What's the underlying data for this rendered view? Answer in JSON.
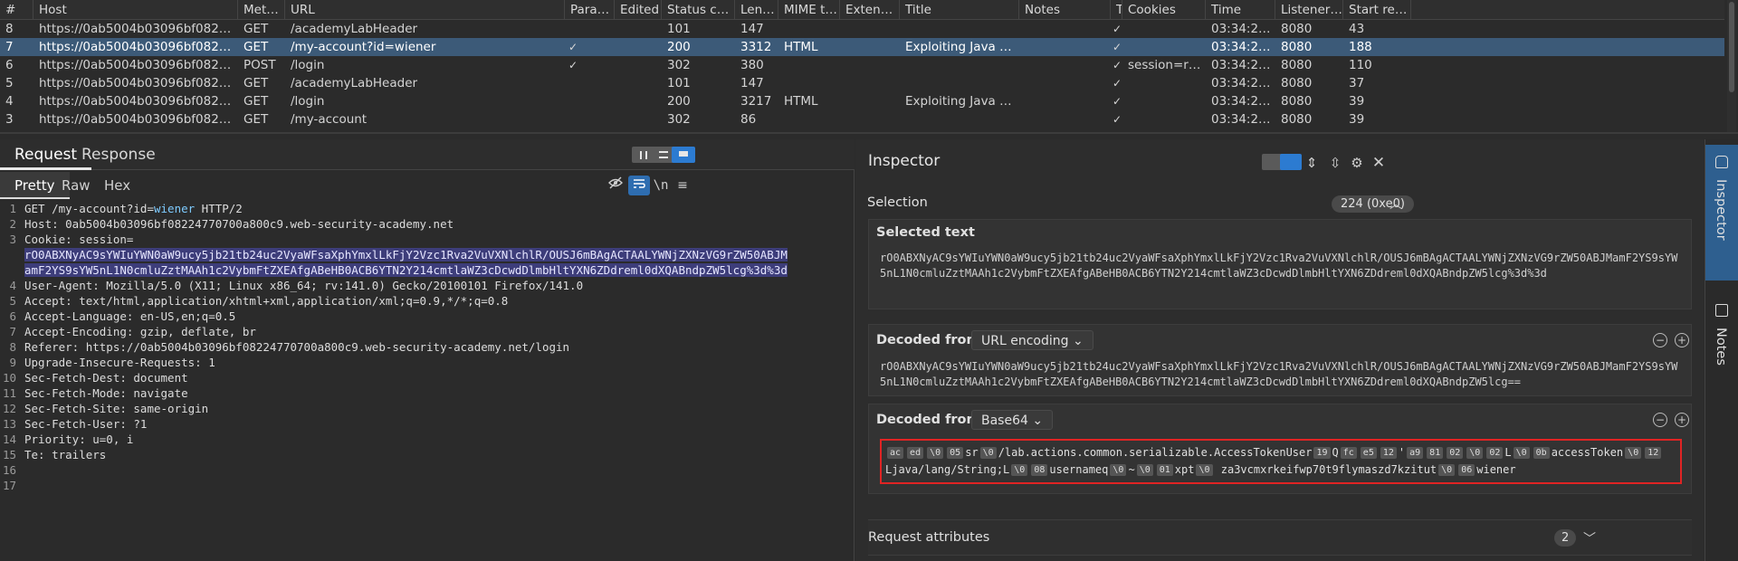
{
  "history": {
    "columns": [
      "#",
      "Host",
      "Method",
      "URL",
      "Params",
      "Edited",
      "Status code",
      "Length",
      "MIME type",
      "Extension",
      "Title",
      "Notes",
      "TLS",
      "Cookies",
      "Time",
      "Listener port",
      "Start respon"
    ],
    "rows": [
      {
        "num": "8",
        "host": "https://0ab5004b03096bf082247707...",
        "method": "GET",
        "url": "/academyLabHeader",
        "params": "",
        "status": "101",
        "length": "147",
        "mime": "",
        "title": "",
        "tls": "✓",
        "cookies": "",
        "time": "03:34:27 29 ...",
        "port": "8080",
        "start": "43"
      },
      {
        "num": "7",
        "host": "https://0ab5004b03096bf082247707...",
        "method": "GET",
        "url": "/my-account?id=wiener",
        "params": "✓",
        "status": "200",
        "length": "3312",
        "mime": "HTML",
        "title": "Exploiting Java deser...",
        "tls": "✓",
        "cookies": "",
        "time": "03:34:27 29 ...",
        "port": "8080",
        "start": "188"
      },
      {
        "num": "6",
        "host": "https://0ab5004b03096bf082247707...",
        "method": "POST",
        "url": "/login",
        "params": "✓",
        "status": "302",
        "length": "380",
        "mime": "",
        "title": "",
        "tls": "✓",
        "cookies": "session=rO0A...",
        "time": "03:34:27 29 ...",
        "port": "8080",
        "start": "110"
      },
      {
        "num": "5",
        "host": "https://0ab5004b03096bf082247707...",
        "method": "GET",
        "url": "/academyLabHeader",
        "params": "",
        "status": "101",
        "length": "147",
        "mime": "",
        "title": "",
        "tls": "✓",
        "cookies": "",
        "time": "03:34:24 29 ...",
        "port": "8080",
        "start": "37"
      },
      {
        "num": "4",
        "host": "https://0ab5004b03096bf082247707...",
        "method": "GET",
        "url": "/login",
        "params": "",
        "status": "200",
        "length": "3217",
        "mime": "HTML",
        "title": "Exploiting Java deser...",
        "tls": "✓",
        "cookies": "",
        "time": "03:34:24 29 ...",
        "port": "8080",
        "start": "39"
      },
      {
        "num": "3",
        "host": "https://0ab5004b03096bf082247707...",
        "method": "GET",
        "url": "/my-account",
        "params": "",
        "status": "302",
        "length": "86",
        "mime": "",
        "title": "",
        "tls": "✓",
        "cookies": "",
        "time": "03:34:24 29 ...",
        "port": "8080",
        "start": "39"
      }
    ]
  },
  "request": {
    "tabs": [
      "Request",
      "Response"
    ],
    "subtabs": [
      "Pretty",
      "Raw",
      "Hex"
    ],
    "newline_label": "\\n",
    "lines": [
      {
        "n": "1",
        "pre": "GET /my-account?id=",
        "param": "wiener",
        "post": " HTTP/2"
      },
      {
        "n": "2",
        "text": "Host: 0ab5004b03096bf08224770700a800c9.web-security-academy.net"
      },
      {
        "n": "3",
        "text": "Cookie: session="
      },
      {
        "n": "",
        "sel": "rO0ABXNyAC9sYWIuYWN0aW9ucy5jb21tb24uc2VyaWFsaXphYmxlLkFjY2Vzc1Rva2VuVXNlchlR/OUSJ6mBAgACTAALYWNjZXNzVG9rZW50ABJM"
      },
      {
        "n": "",
        "sel": "amF2YS9sYW5nL1N0cmluZztMAAh1c2VybmFtZXEAfgABeHB0ACB6YTN2Y214cmtlaWZ3cDcwdDlmbHltYXN6ZDdreml0dXQABndpZW5lcg%3d%3d"
      },
      {
        "n": "4",
        "text": "User-Agent: Mozilla/5.0 (X11; Linux x86_64; rv:141.0) Gecko/20100101 Firefox/141.0"
      },
      {
        "n": "5",
        "text": "Accept: text/html,application/xhtml+xml,application/xml;q=0.9,*/*;q=0.8"
      },
      {
        "n": "6",
        "text": "Accept-Language: en-US,en;q=0.5"
      },
      {
        "n": "7",
        "text": "Accept-Encoding: gzip, deflate, br"
      },
      {
        "n": "8",
        "text": "Referer: https://0ab5004b03096bf08224770700a800c9.web-security-academy.net/login"
      },
      {
        "n": "9",
        "text": "Upgrade-Insecure-Requests: 1"
      },
      {
        "n": "10",
        "text": "Sec-Fetch-Dest: document"
      },
      {
        "n": "11",
        "text": "Sec-Fetch-Mode: navigate"
      },
      {
        "n": "12",
        "text": "Sec-Fetch-Site: same-origin"
      },
      {
        "n": "13",
        "text": "Sec-Fetch-User: ?1"
      },
      {
        "n": "14",
        "text": "Priority: u=0, i"
      },
      {
        "n": "15",
        "text": "Te: trailers"
      },
      {
        "n": "16",
        "text": ""
      },
      {
        "n": "17",
        "text": ""
      }
    ]
  },
  "inspector": {
    "title": "Inspector",
    "selection_label": "Selection",
    "selection_badge": "224 (0xe0)",
    "selected_text_label": "Selected text",
    "selected_text": "rO0ABXNyAC9sYWIuYWN0aW9ucy5jb21tb24uc2VyaWFsaXphYmxlLkFjY2Vzc1Rva2VuVXNlchlR/OUSJ6mBAgACTAALYWNjZXNzVG9rZW50ABJMamF2YS9sYW5nL1N0cmluZztMAAh1c2VybmFtZXEAfgABeHB0ACB6YTN2Y214cmtlaWZ3cDcwdDlmbHltYXN6ZDdreml0dXQABndpZW5lcg%3d%3d",
    "decoded1_label": "Decoded from:",
    "decoded1_type": "URL encoding",
    "decoded1_text": "rO0ABXNyAC9sYWIuYWN0aW9ucy5jb21tb24uc2VyaWFsaXphYmxlLkFjY2Vzc1Rva2VuVXNlchlR/OUSJ6mBAgACTAALYWNjZXNzVG9rZW50ABJMamF2YS9sYW5nL1N0cmluZztMAAh1c2VybmFtZXEAfgABeHB0ACB6YTN2Y214cmtlaWZ3cDcwdDlmbHltYXN6ZDdreml0dXQABndpZW5lcg==",
    "decoded2_label": "Decoded from:",
    "decoded2_type": "Base64",
    "decoded2_parts": [
      {
        "b": "ac"
      },
      {
        "b": "ed"
      },
      {
        "b": "\\0"
      },
      {
        "b": "05"
      },
      {
        "t": "sr"
      },
      {
        "b": "\\0"
      },
      {
        "t": "/lab.actions.common.serializable.AccessTokenUser"
      },
      {
        "b": "19"
      },
      {
        "t": "Q"
      },
      {
        "b": "fc"
      },
      {
        "b": "e5"
      },
      {
        "b": "12"
      },
      {
        "t": "'"
      },
      {
        "b": "a9"
      },
      {
        "b": "81"
      },
      {
        "b": "02"
      },
      {
        "b": "\\0"
      },
      {
        "b": "02"
      },
      {
        "t": "L"
      },
      {
        "b": "\\0"
      },
      {
        "b": "0b"
      },
      {
        "t": "accessToken"
      },
      {
        "b": "\\0"
      },
      {
        "b": "12"
      },
      {
        "t": "Ljava/lang/String;L"
      },
      {
        "b": "\\0"
      },
      {
        "b": "08"
      },
      {
        "t": "usernameq"
      },
      {
        "b": "\\0"
      },
      {
        "t": "~"
      },
      {
        "b": "\\0"
      },
      {
        "b": "01"
      },
      {
        "t": "xpt"
      },
      {
        "b": "\\0"
      },
      {
        "t": " za3vcmxrkeifwp70t9flymaszd7kzitut"
      },
      {
        "b": "\\0"
      },
      {
        "b": "06"
      },
      {
        "t": "wiener"
      }
    ],
    "request_attributes_label": "Request attributes",
    "request_attributes_badge": "2"
  },
  "side_rail": {
    "tabs": [
      "Inspector",
      "Notes"
    ]
  },
  "colors": {
    "selected_row": "#3c5a78",
    "accent": "#2c7bd1",
    "highlight_box": "#e02424"
  }
}
